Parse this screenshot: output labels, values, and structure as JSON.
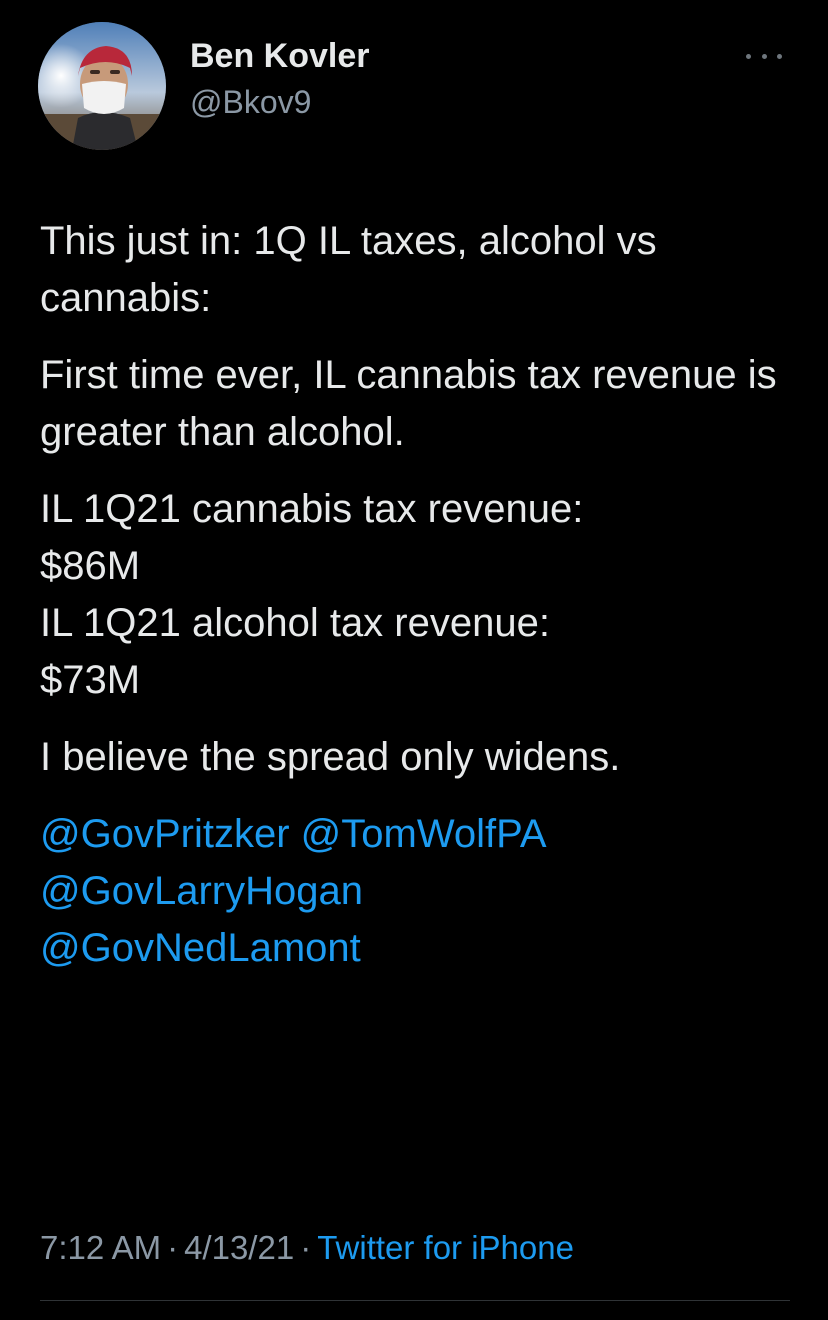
{
  "colors": {
    "background": "#000000",
    "text_primary": "#e7e9ea",
    "text_secondary": "#8b98a5",
    "link": "#1d9bf0",
    "divider": "#2f3336"
  },
  "author": {
    "display_name": "Ben Kovler",
    "handle": "@Bkov9",
    "avatar_icon": "profile-photo"
  },
  "more_icon": "ellipsis-icon",
  "tweet": {
    "para1": "This just in: 1Q IL taxes, alcohol vs cannabis:",
    "para2": "First time ever, IL cannabis tax revenue is greater than alcohol.",
    "para3_line1": "IL 1Q21 cannabis tax revenue:",
    "para3_line2": "$86M",
    "para3_line3": "IL 1Q21 alcohol tax revenue:",
    "para3_line4": "$73M",
    "para4": "I believe the spread only widens.",
    "mentions": [
      "@GovPritzker",
      "@TomWolfPA",
      "@GovLarryHogan",
      "@GovNedLamont"
    ]
  },
  "meta": {
    "time": "7:12 AM",
    "separator": "·",
    "date": "4/13/21",
    "source": "Twitter for iPhone"
  }
}
